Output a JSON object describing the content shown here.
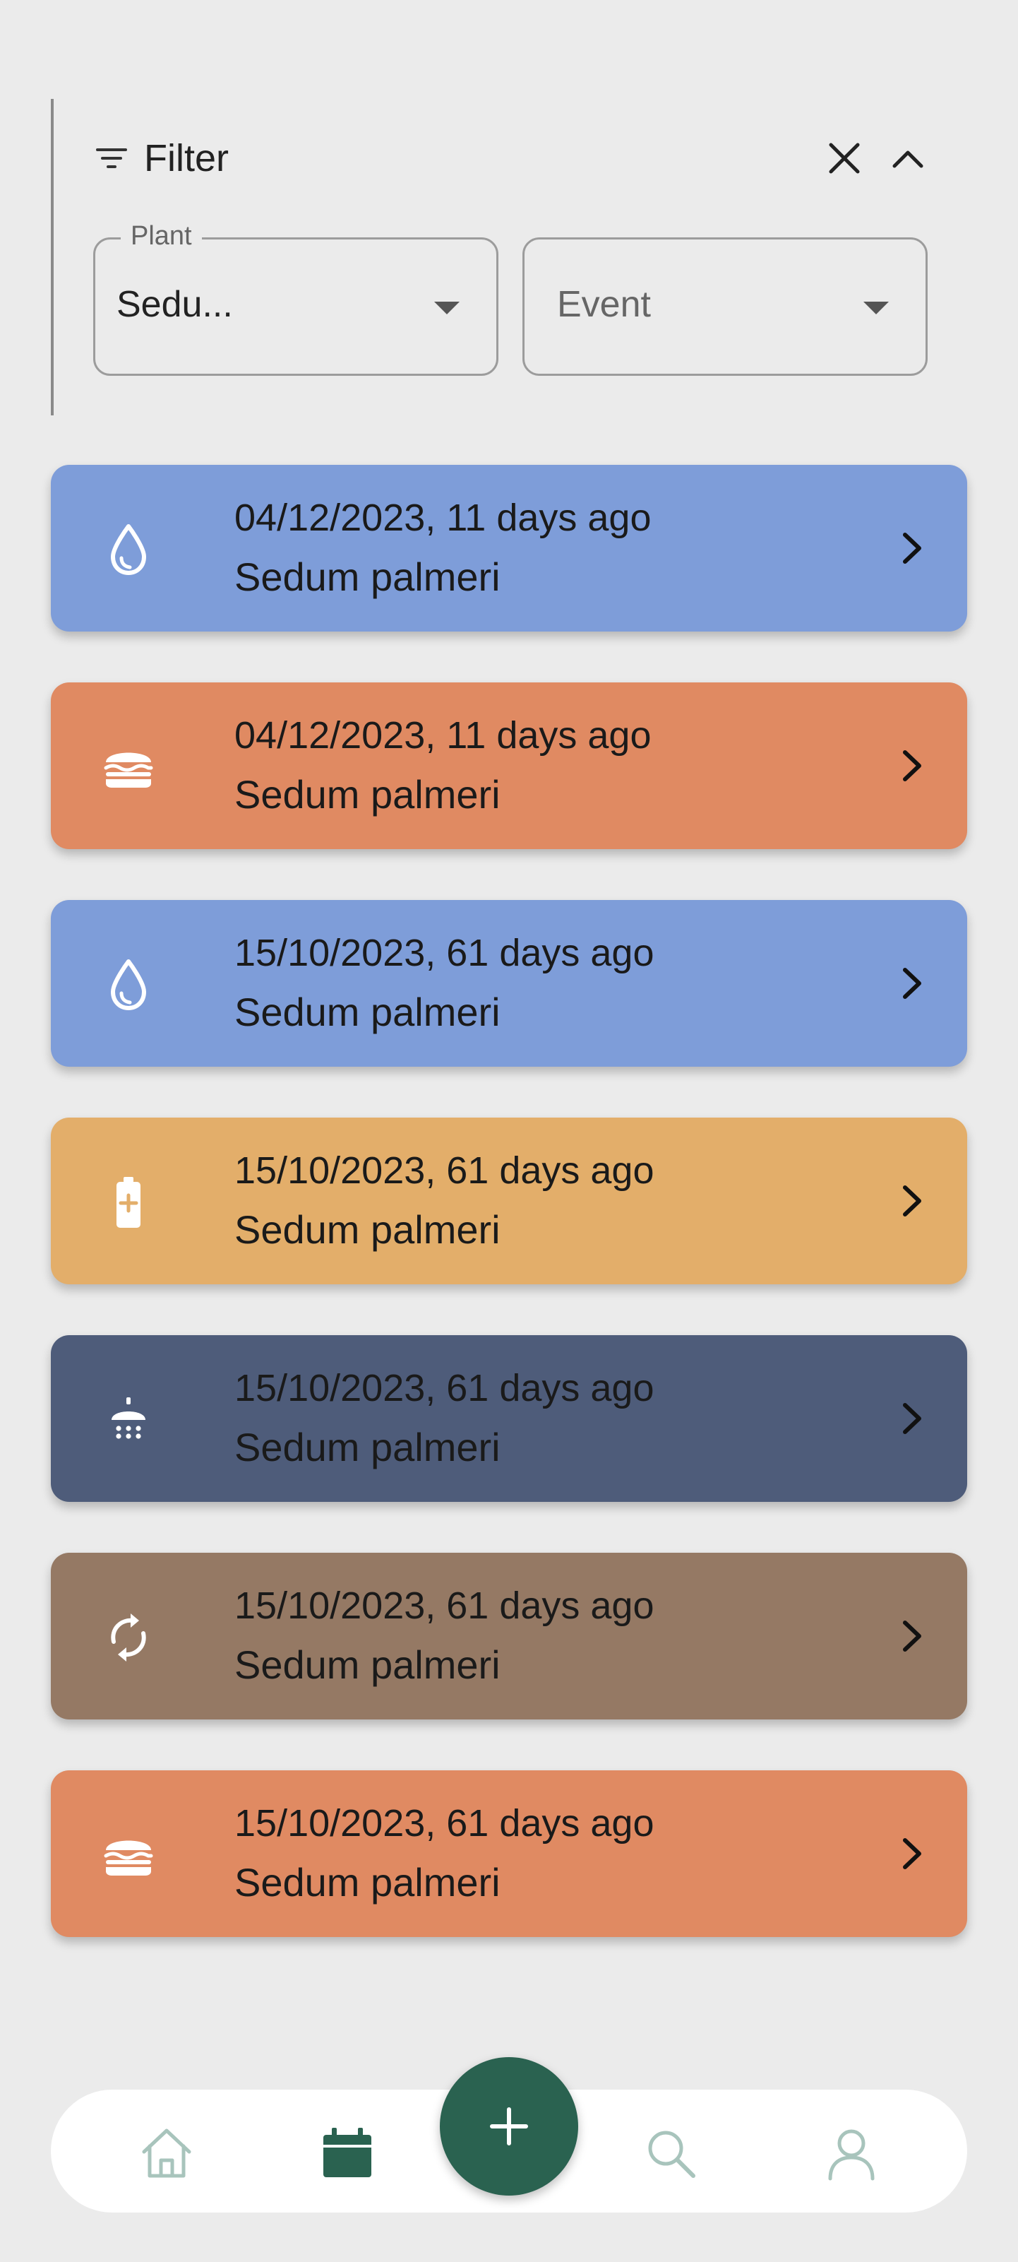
{
  "filter": {
    "title": "Filter",
    "plant_label": "Plant",
    "plant_value": "Sedu...",
    "event_placeholder": "Event"
  },
  "events": [
    {
      "date": "04/12/2023, 11 days ago",
      "plant": "Sedum palmeri",
      "type": "watering",
      "icon": "water-drop-icon",
      "color": "#7e9dd9"
    },
    {
      "date": "04/12/2023, 11 days ago",
      "plant": "Sedum palmeri",
      "type": "fertilizing",
      "icon": "burger-icon",
      "color": "#e08a62"
    },
    {
      "date": "15/10/2023, 61 days ago",
      "plant": "Sedum palmeri",
      "type": "watering",
      "icon": "water-drop-icon",
      "color": "#7e9dd9"
    },
    {
      "date": "15/10/2023, 61 days ago",
      "plant": "Sedum palmeri",
      "type": "biostimulating",
      "icon": "battery-plus-icon",
      "color": "#e3ae6a"
    },
    {
      "date": "15/10/2023, 61 days ago",
      "plant": "Sedum palmeri",
      "type": "misting",
      "icon": "shower-icon",
      "color": "#4e5c7a"
    },
    {
      "date": "15/10/2023, 61 days ago",
      "plant": "Sedum palmeri",
      "type": "repotting",
      "icon": "refresh-icon",
      "color": "#957964"
    },
    {
      "date": "15/10/2023, 61 days ago",
      "plant": "Sedum palmeri",
      "type": "fertilizing",
      "icon": "burger-icon",
      "color": "#e08a62"
    }
  ],
  "nav": {
    "items": [
      "home-icon",
      "calendar-icon",
      "add-icon",
      "search-icon",
      "user-icon"
    ],
    "active": "calendar-icon",
    "accent": "#2a6250",
    "inactive_color": "#a8c4bc"
  }
}
